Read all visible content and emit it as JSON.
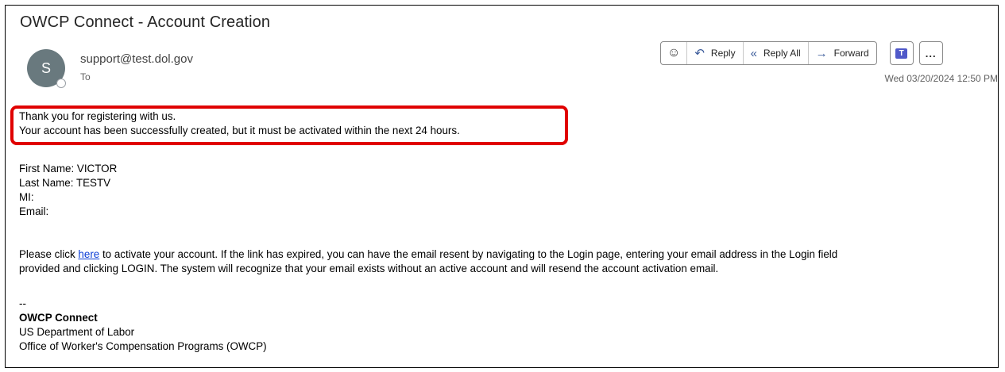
{
  "email": {
    "subject": "OWCP Connect - Account Creation",
    "avatar_initial": "S",
    "sender": "support@test.dol.gov",
    "to_label": "To",
    "date": "Wed 03/20/2024 12:50 PM"
  },
  "toolbar": {
    "reply_label": "Reply",
    "reply_all_label": "Reply All",
    "forward_label": "Forward",
    "teams_label": "T",
    "more_label": "..."
  },
  "body": {
    "line1": "Thank you for registering with us.",
    "line2": "Your account has been successfully created, but it must be activated within the next 24 hours.",
    "first_name": "First Name: VICTOR",
    "last_name": "Last Name: TESTV",
    "mi": "MI:",
    "email": "Email:",
    "para_before_link": "Please click ",
    "link_text": "here",
    "para_after_link": " to activate your account. If the link has expired, you can have the email resent by navigating to the Login page, entering your email address in the Login field",
    "para_line2": "provided and clicking LOGIN. The system will recognize that your email exists without an active account and will resend the account activation email.",
    "sig_dash": "--",
    "sig_name": "OWCP Connect",
    "sig_org": "US Department of Labor",
    "sig_office": "Office of Worker's Compensation Programs (OWCP)"
  },
  "colors": {
    "highlight": "#e00000",
    "avatar": "#69797e",
    "link": "#0b3dd6"
  }
}
